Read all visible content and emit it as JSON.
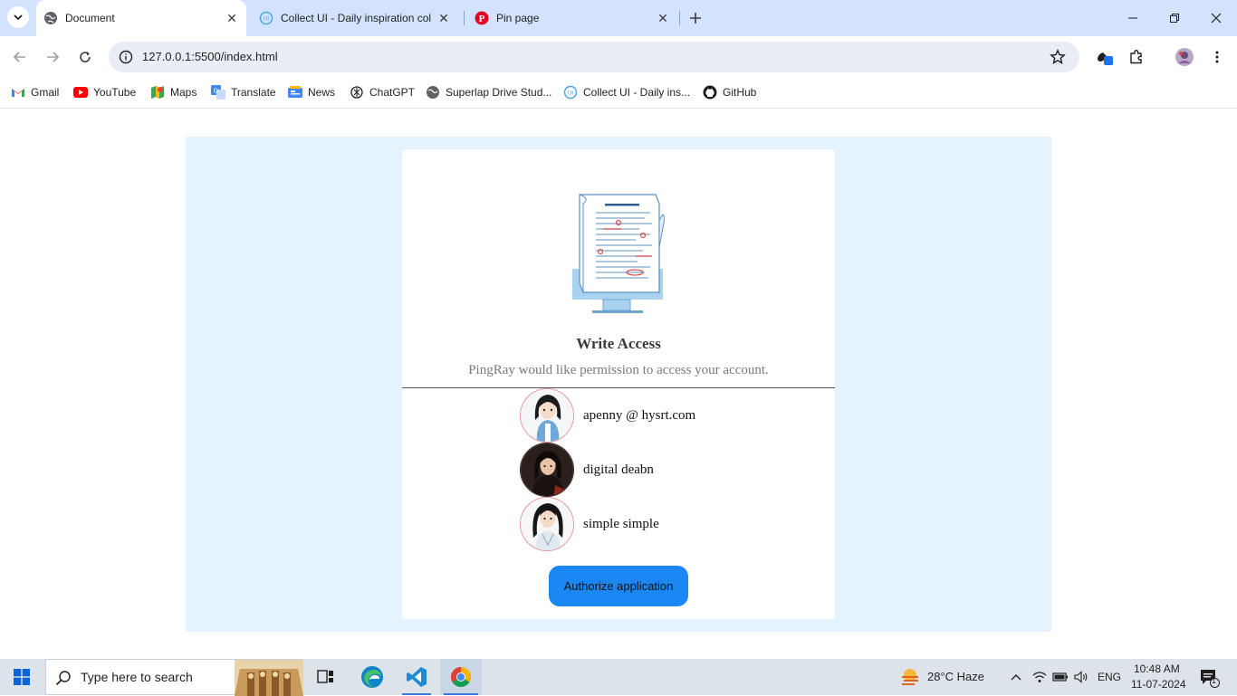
{
  "browser": {
    "tabs": [
      {
        "title": "Document",
        "active": true,
        "icon": "globe-icon"
      },
      {
        "title": "Collect UI - Daily inspiration col",
        "active": false,
        "icon": "collectui-icon"
      },
      {
        "title": "Pin page",
        "active": false,
        "icon": "pinterest-icon"
      }
    ],
    "url": "127.0.0.1:5500/index.html",
    "bookmarks": [
      {
        "label": "Gmail",
        "icon": "gmail-icon"
      },
      {
        "label": "YouTube",
        "icon": "youtube-icon"
      },
      {
        "label": "Maps",
        "icon": "maps-icon"
      },
      {
        "label": "Translate",
        "icon": "translate-icon"
      },
      {
        "label": "News",
        "icon": "news-icon"
      },
      {
        "label": "ChatGPT",
        "icon": "chatgpt-icon"
      },
      {
        "label": "Superlap Drive Stud...",
        "icon": "globe-icon"
      },
      {
        "label": "Collect UI - Daily ins...",
        "icon": "collectui-icon"
      },
      {
        "label": "GitHub",
        "icon": "github-icon"
      }
    ]
  },
  "card": {
    "title": "Write Access",
    "subtitle": "PingRay would like permission to access your account.",
    "accounts": [
      {
        "name": "apenny @ hysrt.com",
        "avatar": "avatar-girl-denim"
      },
      {
        "name": "digital deabn",
        "avatar": "avatar-girl-dark"
      },
      {
        "name": "simple simple",
        "avatar": "avatar-girl-white"
      }
    ],
    "authorize_label": "Authorize application"
  },
  "colors": {
    "panel_bg": "#e5f2ff",
    "button_bg": "#1a87f5",
    "tabstrip_bg": "#d3e3fd"
  },
  "taskbar": {
    "search_placeholder": "Type here to search",
    "weather": "28°C  Haze",
    "language": "ENG",
    "time": "10:48 AM",
    "date": "11-07-2024",
    "notification_count": "1"
  }
}
